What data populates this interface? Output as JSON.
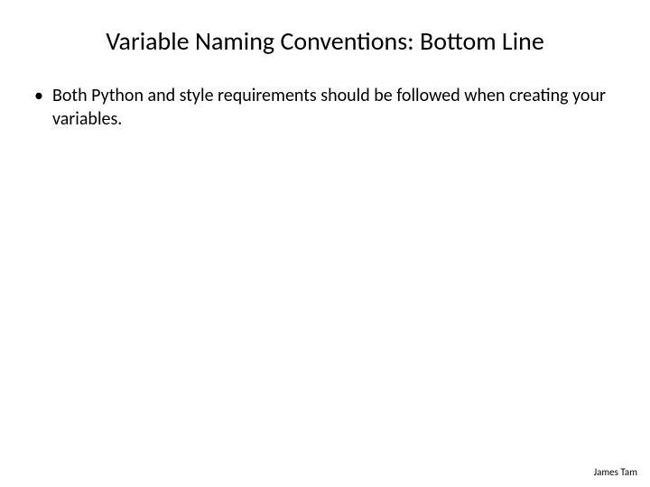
{
  "slide": {
    "title": "Variable Naming Conventions: Bottom Line",
    "bullets": [
      {
        "marker": "•",
        "text": "Both Python and style requirements should be followed when creating your variables."
      }
    ],
    "footer": "James Tam"
  }
}
